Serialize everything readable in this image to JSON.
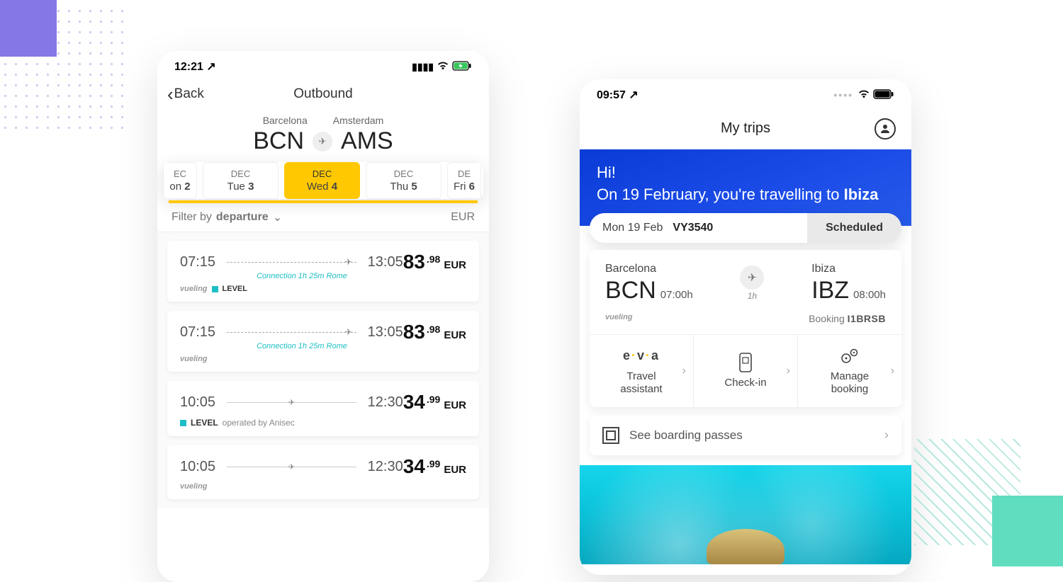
{
  "left": {
    "status": {
      "time": "12:21",
      "loc_icon": "↗"
    },
    "nav": {
      "back": "Back",
      "title": "Outbound"
    },
    "route": {
      "fromCity": "Barcelona",
      "fromCode": "BCN",
      "toCity": "Amsterdam",
      "toCode": "AMS"
    },
    "dates": [
      {
        "month": "EC",
        "day": "on 2",
        "partial": "l"
      },
      {
        "month": "DEC",
        "day": "Tue 3"
      },
      {
        "month": "DEC",
        "day": "Wed 4",
        "active": true
      },
      {
        "month": "DEC",
        "day": "Thu 5"
      },
      {
        "month": "DE",
        "day": "Fri 6",
        "partial": "r"
      }
    ],
    "filter": {
      "label": "Filter by ",
      "emph": "departure",
      "currency": "EUR"
    },
    "flights": [
      {
        "dep": "07:15",
        "arr": "13:05",
        "conn": "Connection 1h 25m Rome",
        "priceMain": "83",
        "priceDec": ".98",
        "airlines": "vueling + LEVEL",
        "dashed": true
      },
      {
        "dep": "07:15",
        "arr": "13:05",
        "conn": "Connection 1h 25m Rome",
        "priceMain": "83",
        "priceDec": ".98",
        "airlines": "vueling",
        "dashed": true
      },
      {
        "dep": "10:05",
        "arr": "12:30",
        "priceMain": "34",
        "priceDec": ".99",
        "airlines": "LEVEL operated by Anisec",
        "dashed": false
      },
      {
        "dep": "10:05",
        "arr": "12:30",
        "priceMain": "34",
        "priceDec": ".99",
        "airlines": "vueling",
        "dashed": false
      }
    ],
    "priceCur": "EUR"
  },
  "right": {
    "status": {
      "time": "09:57"
    },
    "title": "My trips",
    "hero": {
      "greeting": "Hi!",
      "line": "On 19 February, you're travelling to ",
      "dest": "Ibiza"
    },
    "pill": {
      "date": "Mon 19 Feb",
      "flight": "VY3540",
      "status": "Scheduled"
    },
    "trip": {
      "fromCity": "Barcelona",
      "fromCode": "BCN",
      "fromTime": "07:00h",
      "duration": "1h",
      "toCity": "Ibiza",
      "toCode": "IBZ",
      "toTime": "08:00h",
      "airline": "vueling",
      "bookingLabel": "Booking ",
      "bookingRef": "I1BRSB"
    },
    "actions": {
      "a0": "Travel\nassistant",
      "a1": "Check-in",
      "a2": "Manage\nbooking"
    },
    "boarding": "See boarding passes"
  }
}
